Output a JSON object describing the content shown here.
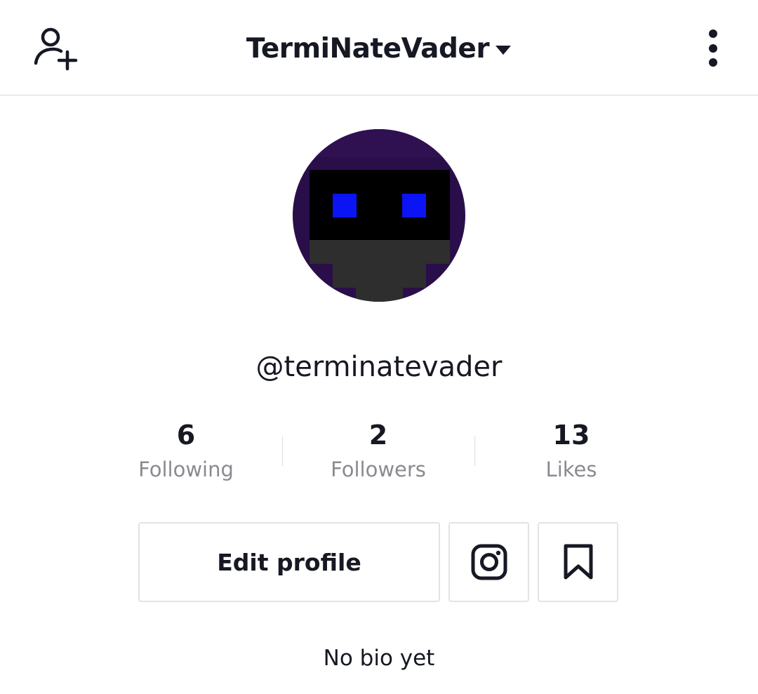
{
  "header": {
    "username_title": "TermiNateVader",
    "icons": {
      "left": "add-user-icon",
      "title_caret": "caret-down-icon",
      "right": "more-vertical-icon"
    }
  },
  "profile": {
    "handle": "@terminatevader",
    "avatar_colors": {
      "background": "#2a0e4a",
      "visor": "#000000",
      "eyes": "#0a14f5",
      "body": "#2e2e2e"
    },
    "stats": [
      {
        "value": "6",
        "label": "Following"
      },
      {
        "value": "2",
        "label": "Followers"
      },
      {
        "value": "13",
        "label": "Likes"
      }
    ],
    "actions": {
      "edit_label": "Edit profile",
      "instagram_icon": "instagram-icon",
      "bookmark_icon": "bookmark-icon"
    },
    "bio": "No bio yet"
  }
}
